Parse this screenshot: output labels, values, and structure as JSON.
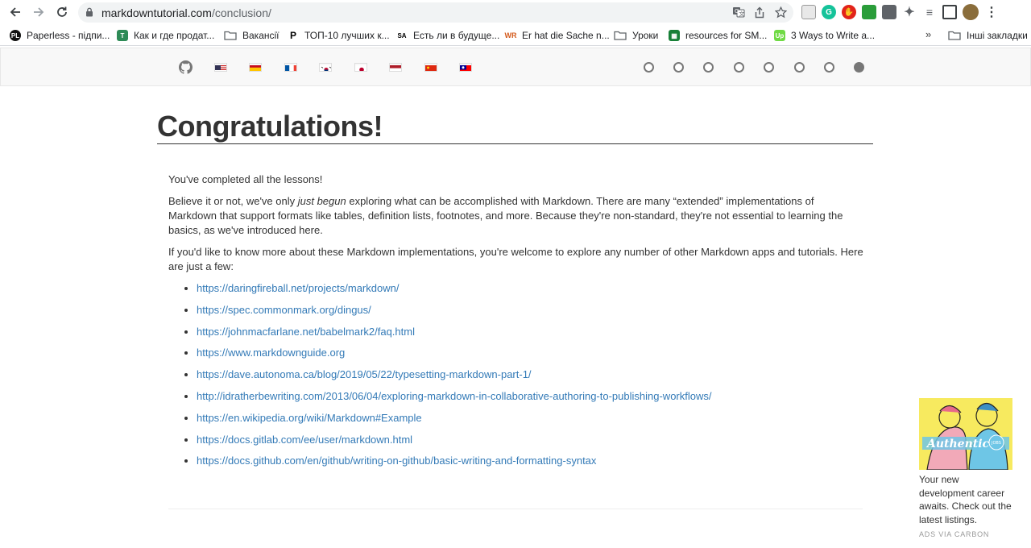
{
  "browser": {
    "url_host": "markdowntutorial.com",
    "url_path": "/conclusion/",
    "bookmarks": [
      {
        "label": "Paperless - підпи...",
        "icon": "paperless-icon",
        "color": "#1a1a1a"
      },
      {
        "label": "Как и где продат...",
        "icon": "table-icon",
        "color": "#2e8b57"
      },
      {
        "label": "Вакансії",
        "icon": "folder-icon",
        "color": ""
      },
      {
        "label": "ТОП-10 лучших к...",
        "icon": "p-icon",
        "color": "#000000"
      },
      {
        "label": "Есть ли в будуще...",
        "icon": "sa-icon",
        "color": "#000000"
      },
      {
        "label": "Er hat die Sache n...",
        "icon": "wr-icon",
        "color": "#d45a1c"
      },
      {
        "label": "Уроки",
        "icon": "folder-icon",
        "color": ""
      },
      {
        "label": "resources for SM...",
        "icon": "sheets-icon",
        "color": "#188038"
      },
      {
        "label": "3 Ways to Write a...",
        "icon": "upwork-icon",
        "color": "#6fda44"
      }
    ],
    "more_bookmarks": "»",
    "other_bookmarks": "Інші закладки"
  },
  "site_nav": {
    "flags": [
      "us-flag",
      "es-flag",
      "fr-flag",
      "kr-flag",
      "jp-flag",
      "nl-flag",
      "cn-flag",
      "tw-flag"
    ],
    "lesson_dots": 8,
    "active_dot": 8
  },
  "page": {
    "title": "Congratulations!",
    "p1": "You've completed all the lessons!",
    "p2_before": "Believe it or not, we've only ",
    "p2_em": "just begun",
    "p2_after": " exploring what can be accomplished with Markdown. There are many “extended” implementations of Markdown that support formats like tables, definition lists, footnotes, and more. Because they're non-standard, they're not essential to learning the basics, as we've introduced here.",
    "p3": "If you'd like to know more about these Markdown implementations, you're welcome to explore any number of other Markdown apps and tutorials. Here are just a few:",
    "links": [
      "https://daringfireball.net/projects/markdown/",
      "https://spec.commonmark.org/dingus/",
      "https://johnmacfarlane.net/babelmark2/faq.html",
      "https://www.markdownguide.org",
      "https://dave.autonoma.ca/blog/2019/05/22/typesetting-markdown-part-1/",
      "http://idratherbewriting.com/2013/06/04/exploring-markdown-in-collaborative-authoring-to-publishing-workflows/",
      "https://en.wikipedia.org/wiki/Markdown#Example",
      "https://docs.gitlab.com/ee/user/markdown.html",
      "https://docs.github.com/en/github/writing-on-github/basic-writing-and-formatting-syntax"
    ]
  },
  "ad": {
    "image_text": "Authentic",
    "badge": "JOBS",
    "text": "Your new development career awaits. Check out the latest listings.",
    "via": "ADS VIA CARBON"
  },
  "colors": {
    "link": "#337ab7",
    "nav_bg": "#f8f8f8",
    "ad_yellow": "#f7ea5f"
  }
}
